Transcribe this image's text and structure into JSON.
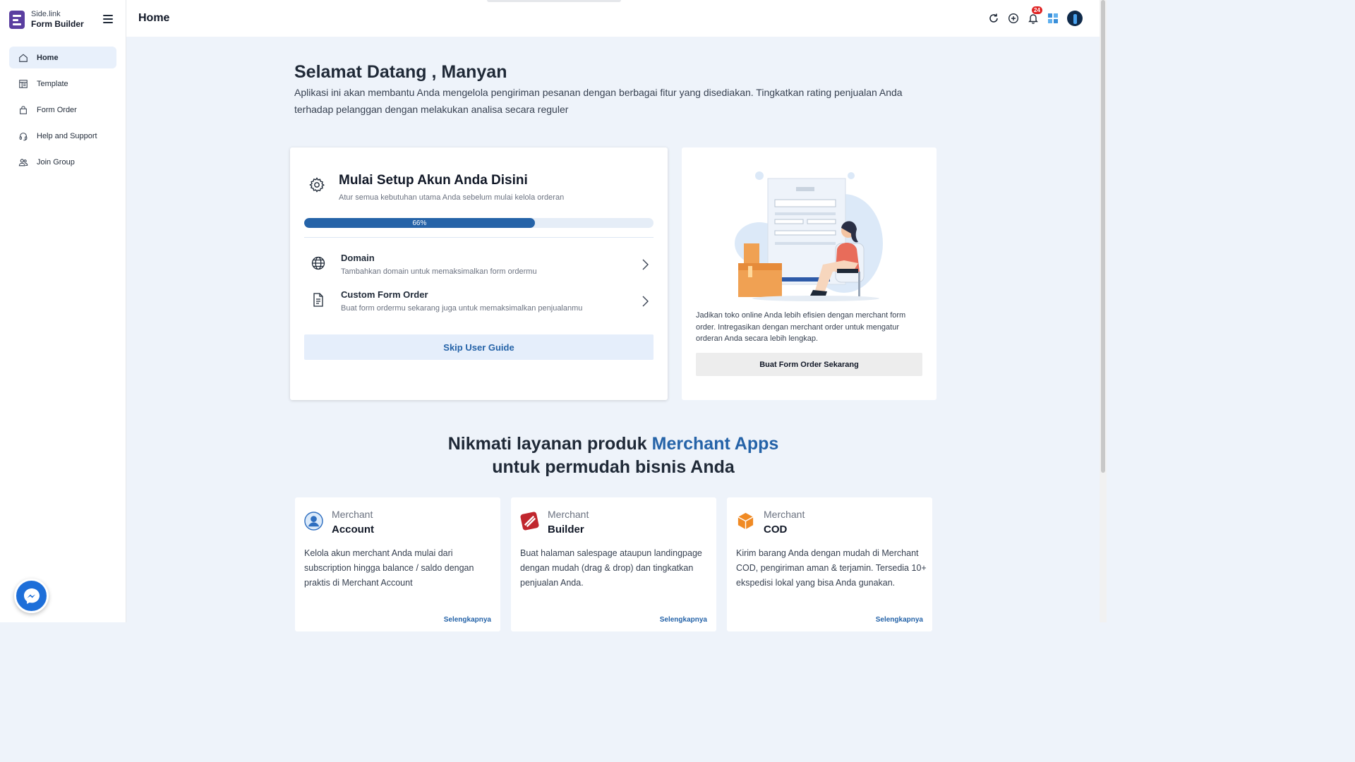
{
  "brand": {
    "sub": "Side.link",
    "name": "Form Builder"
  },
  "sidebar": {
    "items": [
      {
        "label": "Home",
        "icon": "home-icon",
        "active": true
      },
      {
        "label": "Template",
        "icon": "template-icon"
      },
      {
        "label": "Form Order",
        "icon": "bag-icon"
      },
      {
        "label": "Help and Support",
        "icon": "headset-icon"
      },
      {
        "label": "Join Group",
        "icon": "group-icon"
      }
    ]
  },
  "header": {
    "title": "Home",
    "notification_count": "24",
    "icons": [
      "refresh-icon",
      "add-circle-icon",
      "bell-icon",
      "apps-grid-icon",
      "avatar"
    ]
  },
  "welcome": {
    "title": "Selamat Datang , Manyan",
    "description": "Aplikasi ini akan membantu Anda mengelola pengiriman pesanan dengan berbagai fitur yang disediakan. Tingkatkan rating penjualan Anda terhadap pelanggan dengan melakukan analisa secara reguler"
  },
  "setup": {
    "title": "Mulai Setup Akun Anda Disini",
    "subtitle": "Atur semua kebutuhan utama Anda sebelum mulai kelola orderan",
    "progress_label": "66%",
    "progress_value": 0.66,
    "steps": [
      {
        "title": "Domain",
        "desc": "Tambahkan domain untuk memaksimalkan form ordermu",
        "icon": "globe-icon"
      },
      {
        "title": "Custom Form Order",
        "desc": "Buat form ordermu sekarang juga untuk memaksimalkan penjualanmu",
        "icon": "document-icon"
      }
    ],
    "skip_label": "Skip User Guide"
  },
  "promo": {
    "text": "Jadikan toko online Anda lebih efisien dengan merchant form order. Intregasikan dengan merchant order untuk mengatur orderan Anda secara lebih lengkap.",
    "button": "Buat Form Order Sekarang"
  },
  "section": {
    "line1_prefix": "Nikmati layanan produk ",
    "line1_accent": "Merchant Apps",
    "line2": "untuk permudah bisnis Anda"
  },
  "products": [
    {
      "kicker": "Merchant",
      "name": "Account",
      "desc": "Kelola akun merchant Anda mulai dari subscription hingga balance / saldo dengan praktis di Merchant Account",
      "link": "Selengkapnya",
      "icon": "user-icon"
    },
    {
      "kicker": "Merchant",
      "name": "Builder",
      "desc": "Buat halaman salespage ataupun landingpage dengan mudah (drag & drop) dan tingkatkan penjualan Anda.",
      "link": "Selengkapnya",
      "icon": "builder-icon"
    },
    {
      "kicker": "Merchant",
      "name": "COD",
      "desc": "Kirim barang Anda dengan mudah di Merchant COD, pengiriman aman & terjamin. Tersedia 10+ ekspedisi lokal yang bisa Anda gunakan.",
      "link": "Selengkapnya",
      "icon": "box-icon"
    }
  ],
  "colors": {
    "accent": "#2563a8",
    "brand": "#5a3ea0",
    "badge": "#e02424",
    "background": "#eef3fa"
  }
}
